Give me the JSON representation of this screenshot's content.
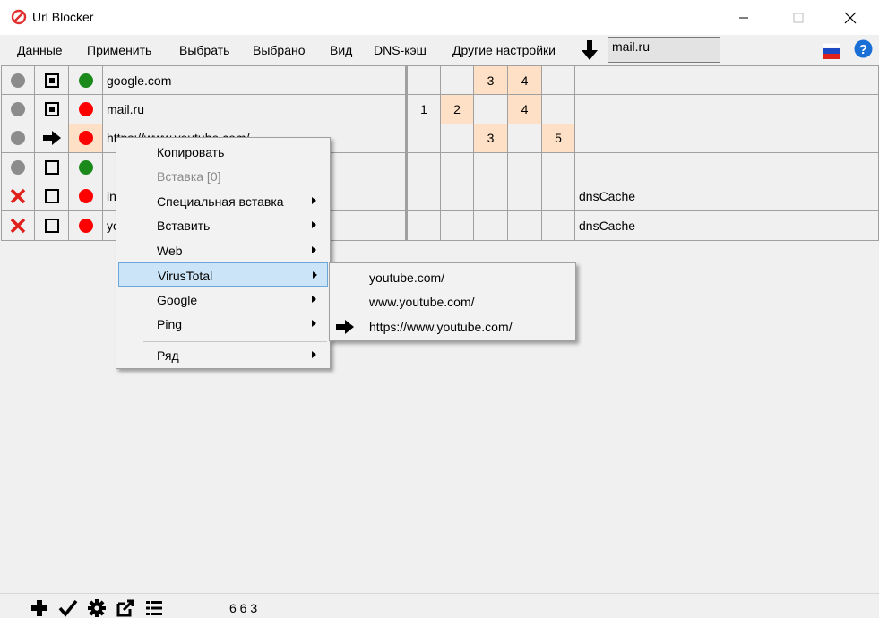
{
  "window": {
    "title": "Url Blocker",
    "app_icon": "prohibited-icon",
    "controls": [
      "minimize-icon",
      "maximize-icon",
      "close-icon"
    ]
  },
  "menu": [
    "Данные",
    "Применить",
    "Выбрать",
    "Выбрано",
    "Вид",
    "DNS-кэш",
    "Другие настройки"
  ],
  "search": {
    "value": "mail.ru"
  },
  "toolbar_icons": [
    "arrow-down-icon",
    "flag-ru-icon",
    "help-icon"
  ],
  "rows": [
    {
      "status": "gray-dot",
      "mode": "square-filled",
      "state": "green",
      "url": "google.com",
      "c": [
        "",
        "",
        "3",
        "4",
        ""
      ],
      "dns": ""
    },
    {
      "status": "gray-dot",
      "mode": "square-filled",
      "state": "red",
      "url": "mail.ru",
      "c": [
        "1",
        "2",
        "",
        "4",
        ""
      ],
      "dns": ""
    },
    {
      "status": "gray-dot",
      "mode": "arrow-right",
      "state": "red",
      "url": "https://www.youtube.com/",
      "c": [
        "",
        "",
        "3",
        "",
        "5"
      ],
      "dns": ""
    },
    {
      "status": "gray-dot",
      "mode": "square-empty",
      "state": "green",
      "url": "",
      "c": [
        "",
        "",
        "",
        "",
        ""
      ],
      "dns": ""
    },
    {
      "status": "red-x",
      "mode": "square-empty",
      "state": "red",
      "url": "in",
      "c": [
        "",
        "",
        "",
        "",
        ""
      ],
      "dns": "dnsCache"
    },
    {
      "status": "red-x",
      "mode": "square-empty",
      "state": "red",
      "url": "yo",
      "c": [
        "",
        "",
        "",
        "",
        ""
      ],
      "dns": "dnsCache"
    }
  ],
  "context_menu": {
    "items": [
      {
        "label": "Копировать",
        "submenu": false,
        "disabled": false
      },
      {
        "label": "Вставка [0]",
        "submenu": false,
        "disabled": true
      },
      {
        "label": "Специальная вставка",
        "submenu": true,
        "disabled": false
      },
      {
        "label": "Вставить",
        "submenu": true,
        "disabled": false
      },
      {
        "label": "Web",
        "submenu": true,
        "disabled": false
      },
      {
        "label": "VirusTotal",
        "submenu": true,
        "disabled": false,
        "active": true
      },
      {
        "label": "Google",
        "submenu": true,
        "disabled": false
      },
      {
        "label": "Ping",
        "submenu": true,
        "disabled": false
      },
      {
        "label": "Ряд",
        "submenu": true,
        "disabled": false
      }
    ]
  },
  "submenu": {
    "items": [
      "youtube.com/",
      "www.youtube.com/",
      "https://www.youtube.com/"
    ],
    "current_marker": "arrow-right-icon"
  },
  "statusbar": {
    "icons": [
      "plus-icon",
      "check-icon",
      "gear-icon",
      "export-icon",
      "list-icon"
    ],
    "counts": "6 6 3"
  },
  "colors": {
    "peach": "#fde0c5",
    "menu_highlight": "#cce4f7",
    "red": "#ff0000",
    "green": "#1b8a1b"
  }
}
